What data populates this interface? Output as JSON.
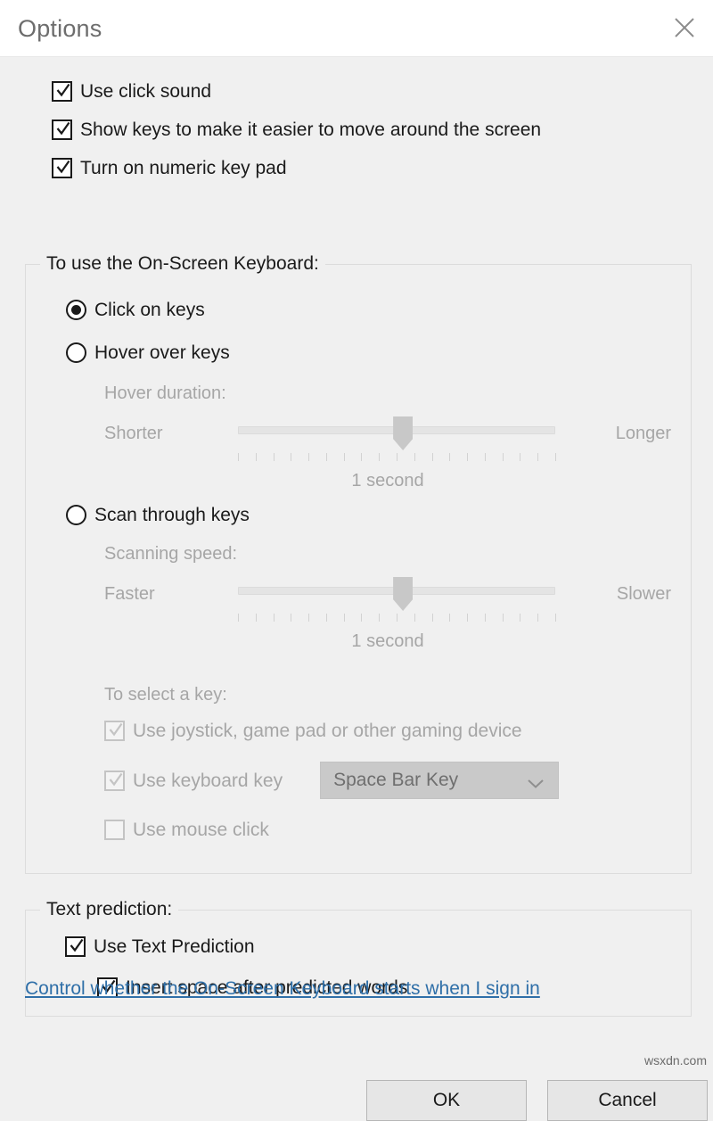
{
  "window": {
    "title": "Options",
    "close_icon": "close-icon"
  },
  "top_options": [
    {
      "label": "Use click sound",
      "checked": true
    },
    {
      "label": "Show keys to make it easier to move around the screen",
      "checked": true
    },
    {
      "label": "Turn on numeric key pad",
      "checked": true
    }
  ],
  "keyboard_group": {
    "legend": "To use the On-Screen Keyboard:",
    "modes": [
      {
        "label": "Click on keys",
        "selected": true
      },
      {
        "label": "Hover over keys",
        "selected": false
      },
      {
        "label": "Scan through keys",
        "selected": false
      }
    ],
    "hover_slider": {
      "caption": "Hover duration:",
      "left_label": "Shorter",
      "right_label": "Longer",
      "value_label": "1 second",
      "position_percent": 52,
      "tick_count": 19
    },
    "scan_slider": {
      "caption": "Scanning speed:",
      "left_label": "Faster",
      "right_label": "Slower",
      "value_label": "1 second",
      "position_percent": 52,
      "tick_count": 19
    },
    "select_key": {
      "caption": "To select a key:",
      "joystick": {
        "label": "Use joystick, game pad or other gaming device",
        "checked": true,
        "disabled": true
      },
      "keyboard_key": {
        "label": "Use keyboard key",
        "checked": true,
        "disabled": true
      },
      "keyboard_key_combo": {
        "value": "Space Bar Key",
        "chevron_icon": "chevron-down-icon"
      },
      "mouse_click": {
        "label": "Use mouse click",
        "checked": false,
        "disabled": true
      }
    }
  },
  "text_prediction_group": {
    "legend": "Text prediction:",
    "use_text_prediction": {
      "label": "Use Text Prediction",
      "checked": true
    },
    "insert_space": {
      "label": "Insert space after predicted words",
      "checked": true
    }
  },
  "help_link": {
    "label": "Control whether the On-Screen Keyboard starts when I sign in",
    "color": "#2f6fa8"
  },
  "buttons": {
    "ok": "OK",
    "cancel": "Cancel"
  },
  "watermark": "wsxdn.com"
}
